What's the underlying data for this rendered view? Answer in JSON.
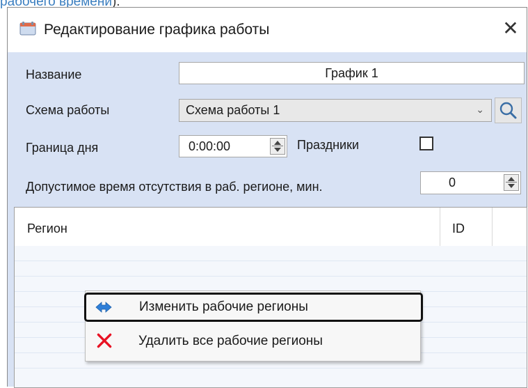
{
  "background_link": {
    "text": "рабочего времени",
    "after": ")."
  },
  "dialog": {
    "title": "Редактирование графика работы",
    "close_glyph": "✕",
    "name_label": "Название",
    "name_value": "График 1",
    "scheme_label": "Схема работы",
    "scheme_value": "Схема работы 1",
    "day_border_label": "Граница дня",
    "day_border_value": "0:00:00",
    "holidays_label": "Праздники",
    "holidays_checked": false,
    "absence_label": "Допустимое время отсутствия в раб. регионе, мин.",
    "absence_value": "0",
    "grid": {
      "columns": [
        "Регион",
        "ID"
      ],
      "rows": []
    }
  },
  "context_menu": {
    "items": [
      {
        "label": "Изменить рабочие регионы",
        "icon": "double-arrow-icon",
        "highlighted": true
      },
      {
        "label": "Удалить все рабочие регионы",
        "icon": "red-x-icon",
        "highlighted": false
      }
    ]
  },
  "colors": {
    "dialog_bg": "#d8e2f4",
    "link": "#3c7fc0",
    "delete_icon": "#e81123",
    "change_icon": "#2f7fd8"
  }
}
